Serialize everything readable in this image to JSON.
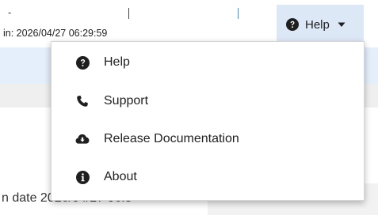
{
  "header": {
    "dash_fragment": "-",
    "login_time": "in: 2026/04/27 06:29:59",
    "help_button": {
      "label": "Help",
      "icon": "question-circle-icon",
      "caret_icon": "caret-down-icon"
    }
  },
  "background": {
    "date_fragment": "n date 2026/04/27 06:5"
  },
  "help_menu": {
    "items": [
      {
        "label": "Help",
        "icon": "question-circle-icon"
      },
      {
        "label": "Support",
        "icon": "phone-icon"
      },
      {
        "label": "Release Documentation",
        "icon": "cloud-download-icon"
      },
      {
        "label": "About",
        "icon": "info-circle-icon"
      }
    ]
  },
  "colors": {
    "help_button_bg": "#dde8f6",
    "band_blue": "#e4effb",
    "band_gray": "#efefef",
    "text": "#1f1f1f"
  }
}
